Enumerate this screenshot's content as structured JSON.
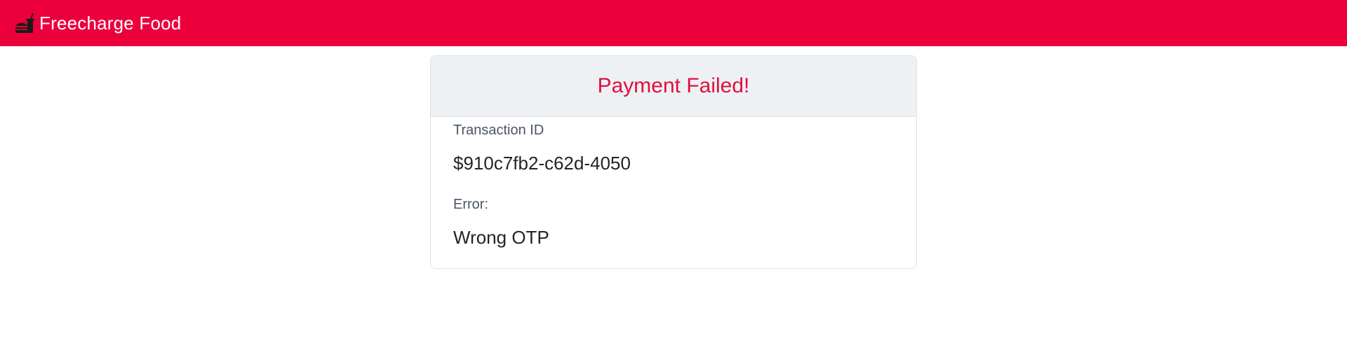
{
  "navbar": {
    "brand_name": "Freecharge Food",
    "brand_icon": "hamburger-food-icon",
    "background_color": "#eb003c"
  },
  "payment_card": {
    "title": "Payment Failed!",
    "title_color": "#e0103f",
    "transaction_id_label": "Transaction ID",
    "transaction_id_value": "$910c7fb2-c62d-4050",
    "error_label": "Error:",
    "error_value": "Wrong OTP"
  }
}
